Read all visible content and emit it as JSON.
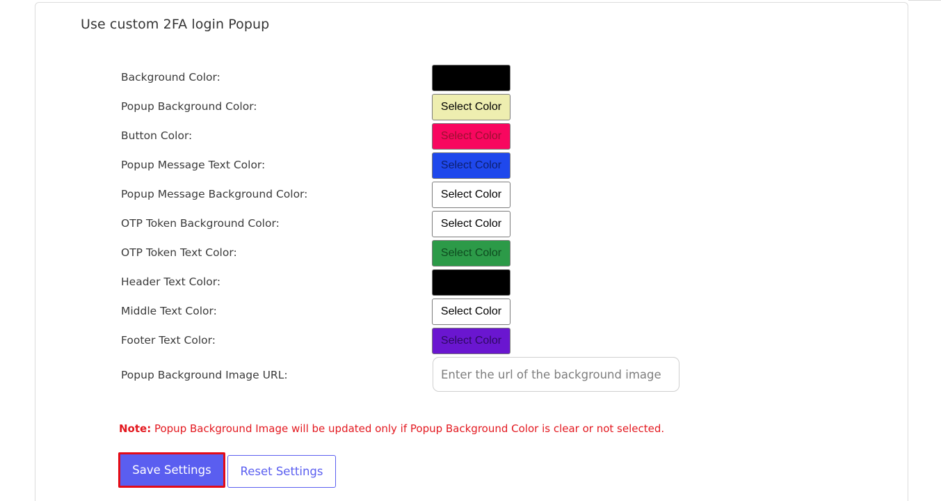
{
  "panel": {
    "title": "Use custom 2FA login Popup"
  },
  "colors": {
    "accent": "#5a5ef0",
    "note": "#e3181f",
    "highlight_border": "#e30b17"
  },
  "rows": [
    {
      "label": "Background Color:",
      "button": "",
      "color": "#000000",
      "text_color": "#000000"
    },
    {
      "label": "Popup Background Color:",
      "button": "Select Color",
      "color": "#eeeeb0",
      "text_color": "#000000"
    },
    {
      "label": "Button Color:",
      "button": "Select Color",
      "color": "#f8075f",
      "text_color": "#9a1030"
    },
    {
      "label": "Popup Message Text Color:",
      "button": "Select Color",
      "color": "#1f48ec",
      "text_color": "#0d1f70"
    },
    {
      "label": "Popup Message Background Color:",
      "button": "Select Color",
      "color": "#ffffff",
      "text_color": "#000000"
    },
    {
      "label": "OTP Token Background Color:",
      "button": "Select Color",
      "color": "#ffffff",
      "text_color": "#000000"
    },
    {
      "label": "OTP Token Text Color:",
      "button": "Select Color",
      "color": "#2c9a48",
      "text_color": "#0e4a1f"
    },
    {
      "label": "Header Text Color:",
      "button": "",
      "color": "#000000",
      "text_color": "#000000"
    },
    {
      "label": "Middle Text Color:",
      "button": "Select Color",
      "color": "#ffffff",
      "text_color": "#000000"
    },
    {
      "label": "Footer Text Color:",
      "button": "Select Color",
      "color": "#6a16d0",
      "text_color": "#2d0a60"
    }
  ],
  "image_url": {
    "label": "Popup Background Image URL:",
    "placeholder": "Enter the url of the background image",
    "value": ""
  },
  "note": {
    "prefix": "Note:",
    "text": " Popup Background Image will be updated only if Popup Background Color is clear or not selected."
  },
  "actions": {
    "save_label": "Save Settings",
    "reset_label": "Reset Settings"
  }
}
